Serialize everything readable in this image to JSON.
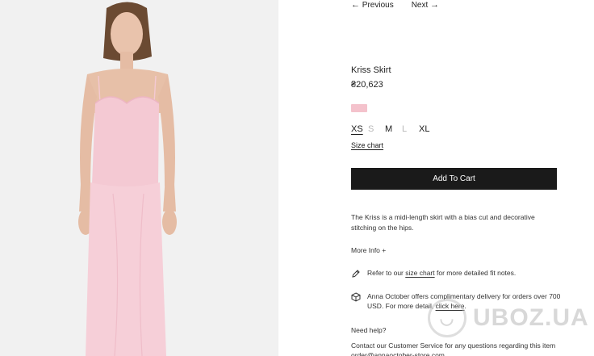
{
  "nav": {
    "previous_label": "Previous",
    "next_label": "Next"
  },
  "product": {
    "title": "Kriss Skirt",
    "price": "₴20,623",
    "swatch_color": "#f4c2cc",
    "sizes": [
      {
        "label": "XS",
        "state": "selected"
      },
      {
        "label": "S",
        "state": "unavailable"
      },
      {
        "label": "M",
        "state": "available"
      },
      {
        "label": "L",
        "state": "unavailable"
      },
      {
        "label": "XL",
        "state": "available"
      }
    ],
    "size_chart_label": "Size chart",
    "add_to_cart_label": "Add To Cart",
    "description": "The Kriss is a midi-length skirt with a bias cut and decorative stitching on the hips.",
    "more_info_label": "More Info +"
  },
  "notes": {
    "fit_prefix": "Refer to our ",
    "fit_link": "size chart",
    "fit_suffix": " for more detailed fit notes.",
    "delivery_prefix": "Anna October offers complimentary delivery for orders over 700 USD. For more detail, ",
    "delivery_link": "click here",
    "delivery_suffix": "."
  },
  "help": {
    "title": "Need help?",
    "text": "Contact our Customer Service for any questions regarding this item order@annaoctober-store.com"
  },
  "watermark": {
    "text": "UBOZ.UA"
  },
  "colors": {
    "button_bg": "#1a1a1a",
    "image_bg": "#f1f1f1",
    "dress": "#f4c9d3"
  }
}
